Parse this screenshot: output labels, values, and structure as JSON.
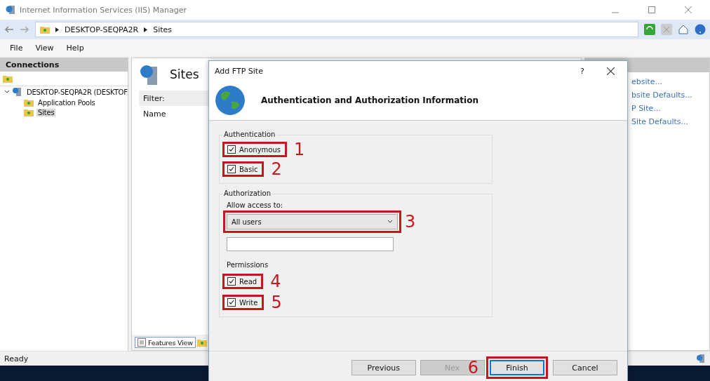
{
  "window": {
    "title": "Internet Information Services (IIS) Manager"
  },
  "address": {
    "crumbs": [
      "DESKTOP-SEQPA2R",
      "Sites"
    ]
  },
  "menu": [
    "File",
    "View",
    "Help"
  ],
  "connections": {
    "title": "Connections",
    "tree": [
      {
        "label": "DESKTOP-SEQPA2R (DESKTOF",
        "expanded": true,
        "selected": false,
        "children": [
          {
            "label": "Application Pools",
            "selected": false
          },
          {
            "label": "Sites",
            "selected": true
          }
        ]
      }
    ]
  },
  "content": {
    "title": "Sites",
    "filter_label": "Filter:",
    "column": "Name",
    "view_tabs": [
      {
        "label": "Features View",
        "selected": true
      }
    ]
  },
  "actions": {
    "links": [
      "ebsite...",
      "bsite Defaults...",
      "P Site...",
      "Site Defaults..."
    ]
  },
  "status_bar": "Ready",
  "dialog": {
    "title": "Add FTP Site",
    "help": "?",
    "heading": "Authentication and Authorization Information",
    "authentication": {
      "label": "Authentication",
      "options": [
        {
          "label": "Anonymous",
          "checked": true,
          "marker": "1"
        },
        {
          "label": "Basic",
          "checked": true,
          "marker": "2"
        }
      ]
    },
    "authorization": {
      "label": "Authorization",
      "access_label": "Allow access to:",
      "access_value": "All users",
      "access_marker": "3"
    },
    "permissions": {
      "label": "Permissions",
      "options": [
        {
          "label": "Read",
          "checked": true,
          "marker": "4"
        },
        {
          "label": "Write",
          "checked": true,
          "marker": "5"
        }
      ]
    },
    "buttons": [
      {
        "label": "Previous",
        "disabled": false,
        "default": false
      },
      {
        "label": "Nex",
        "disabled": true,
        "default": false
      },
      {
        "label": "Finish",
        "disabled": false,
        "default": true,
        "marker": "6"
      },
      {
        "label": "Cancel",
        "disabled": false,
        "default": false
      }
    ]
  }
}
